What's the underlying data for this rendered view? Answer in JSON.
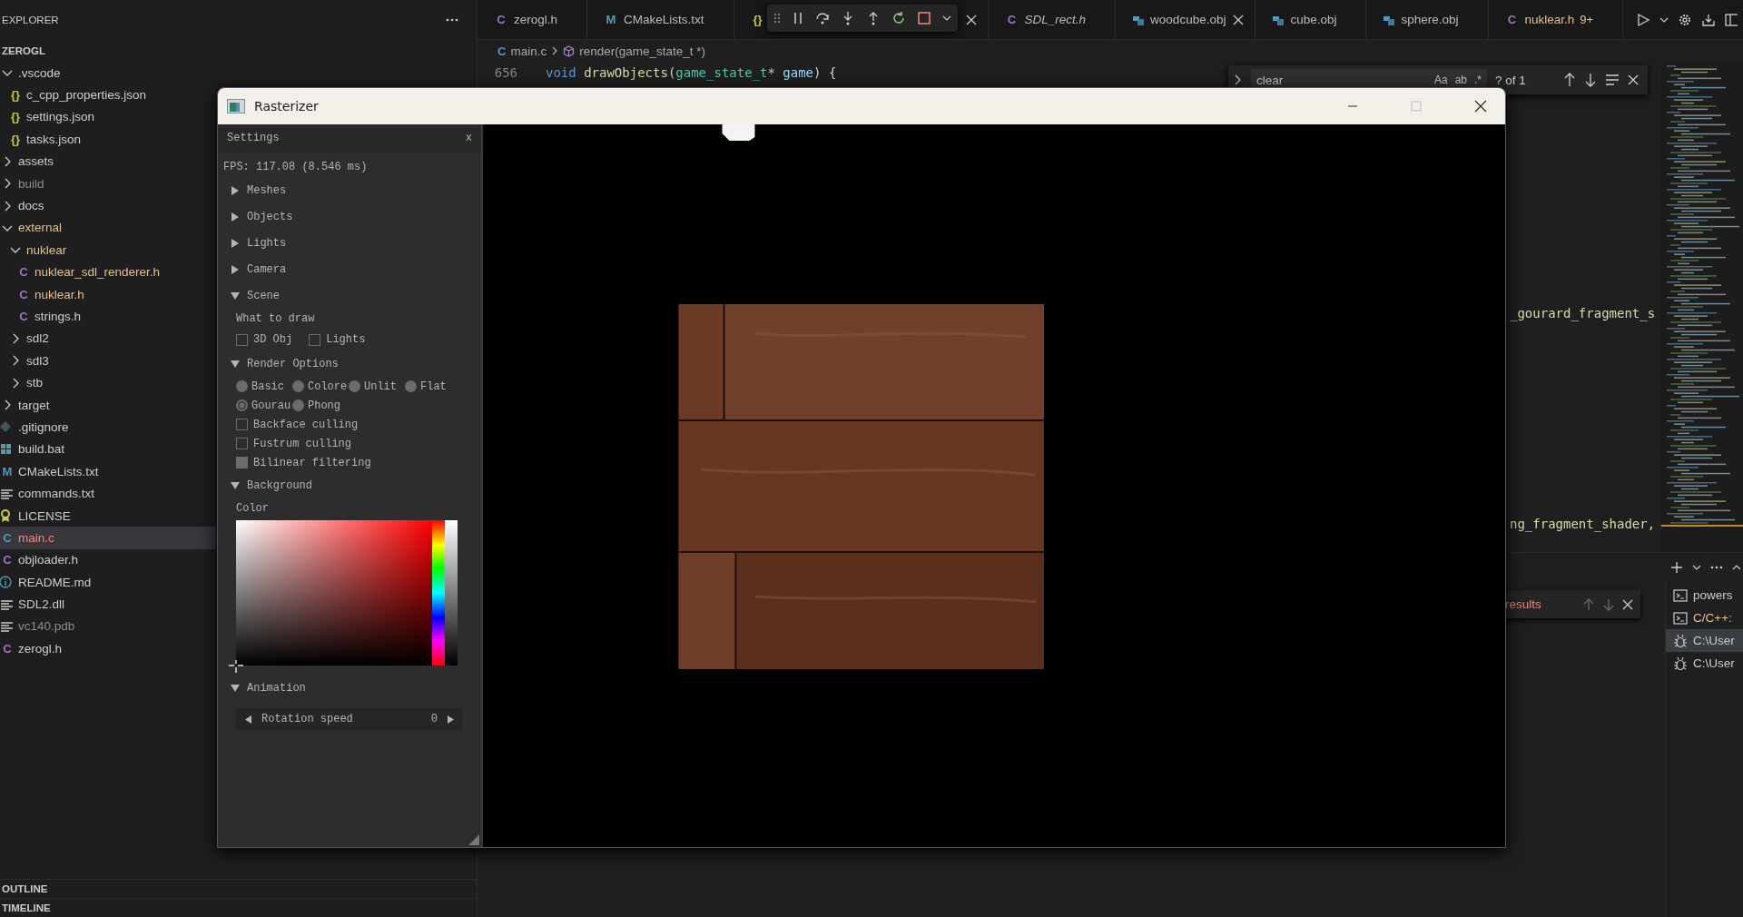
{
  "explorer": {
    "title": "EXPLORER",
    "root": "ZEROGL",
    "tree": [
      {
        "kind": "folder",
        "name": ".vscode",
        "expanded": true,
        "selected": false,
        "children": [
          {
            "kind": "json",
            "glyph": "{}",
            "name": "c_cpp_properties.json",
            "selected": false
          },
          {
            "kind": "json",
            "glyph": "{}",
            "name": "settings.json",
            "selected": false
          },
          {
            "kind": "json",
            "glyph": "{}",
            "name": "tasks.json",
            "selected": false
          }
        ]
      },
      {
        "kind": "folder",
        "name": "assets",
        "expanded": false,
        "selected": false
      },
      {
        "kind": "folder",
        "name": "build",
        "expanded": false,
        "selected": false,
        "ignored": true
      },
      {
        "kind": "folder",
        "name": "docs",
        "expanded": false,
        "selected": false
      },
      {
        "kind": "folder",
        "name": "external",
        "expanded": true,
        "selected": false,
        "modified": true,
        "children": [
          {
            "kind": "folder",
            "name": "nuklear",
            "expanded": true,
            "selected": false,
            "modified": true,
            "children": [
              {
                "kind": "h",
                "glyph": "C",
                "name": "nuklear_sdl_renderer.h",
                "selected": false,
                "modified": true
              },
              {
                "kind": "h",
                "glyph": "C",
                "name": "nuklear.h",
                "selected": false,
                "modified": true
              },
              {
                "kind": "h",
                "glyph": "C",
                "name": "strings.h",
                "selected": false
              }
            ]
          },
          {
            "kind": "folder",
            "name": "sdl2",
            "expanded": false,
            "selected": false
          },
          {
            "kind": "folder",
            "name": "sdl3",
            "expanded": false,
            "selected": false
          },
          {
            "kind": "folder",
            "name": "stb",
            "expanded": false,
            "selected": false
          }
        ]
      },
      {
        "kind": "folder",
        "name": "target",
        "expanded": false,
        "selected": false
      },
      {
        "kind": "git",
        "name": ".gitignore",
        "selected": false
      },
      {
        "kind": "windows",
        "name": "build.bat",
        "selected": false
      },
      {
        "kind": "cmake",
        "glyph": "M",
        "name": "CMakeLists.txt",
        "selected": false
      },
      {
        "kind": "text",
        "name": "commands.txt",
        "selected": false
      },
      {
        "kind": "license",
        "name": "LICENSE",
        "selected": false
      },
      {
        "kind": "c",
        "glyph": "C",
        "name": "main.c",
        "selected": true,
        "has_errors": true
      },
      {
        "kind": "h",
        "glyph": "C",
        "name": "objloader.h",
        "selected": false
      },
      {
        "kind": "info",
        "name": "README.md",
        "selected": false
      },
      {
        "kind": "text",
        "name": "SDL2.dll",
        "selected": false
      },
      {
        "kind": "text",
        "name": "vc140.pdb",
        "selected": false,
        "ignored": true
      },
      {
        "kind": "h",
        "glyph": "C",
        "name": "zerogl.h",
        "selected": false
      }
    ],
    "panels": [
      {
        "title": "OUTLINE"
      },
      {
        "title": "TIMELINE"
      }
    ]
  },
  "tabs": [
    {
      "kind": "h",
      "glyph": "C",
      "label": "zerogl.h"
    },
    {
      "kind": "cmake",
      "glyph": "M",
      "label": "CMakeLists.txt"
    },
    {
      "kind": "json",
      "glyph": "{}",
      "closable": true
    },
    {
      "kind": "h",
      "glyph": "C",
      "label": "SDL_rect.h",
      "preview": true
    },
    {
      "kind": "obj",
      "label": "woodcube.obj",
      "closable": true
    },
    {
      "kind": "obj",
      "label": "cube.obj"
    },
    {
      "kind": "obj",
      "label": "sphere.obj"
    },
    {
      "kind": "h",
      "glyph": "C",
      "label": "nuklear.h",
      "modified": true,
      "badge": "9+"
    }
  ],
  "breadcrumb": [
    {
      "kind": "c",
      "glyph": "C",
      "label": "main.c"
    },
    {
      "kind": "symbol",
      "label": "render(game_state_t *)"
    }
  ],
  "code": {
    "line": {
      "number": "656",
      "tokens": [
        {
          "text": "void ",
          "kind": "keyword"
        },
        {
          "text": "drawObjects",
          "kind": "function"
        },
        {
          "text": "("
        },
        {
          "text": "game_state_t",
          "kind": "type"
        },
        {
          "text": "* "
        },
        {
          "text": "game",
          "kind": "param"
        },
        {
          "text": ") {"
        }
      ]
    },
    "fragments": [
      {
        "text": "_gourard_fragment_s",
        "kind": "function"
      },
      {
        "text": "ng_fragment_shader,",
        "kind": "function"
      }
    ]
  },
  "find": {
    "value": "clear",
    "options": [
      "Aa",
      "ab",
      ".*"
    ],
    "count": "? of 1"
  },
  "rasterizer": {
    "title": "Rasterizer",
    "settings": {
      "title": "Settings",
      "close": "x",
      "fps": "FPS: 117.08 (8.546 ms)",
      "sections": [
        {
          "title": "Meshes",
          "expanded": false
        },
        {
          "title": "Objects",
          "expanded": false
        },
        {
          "title": "Lights",
          "expanded": false
        },
        {
          "title": "Camera",
          "expanded": false
        },
        {
          "title": "Scene",
          "expanded": true,
          "items": [
            {
              "kind": "label",
              "text": "What to draw"
            },
            {
              "kind": "checkbox_row",
              "options": [
                {
                  "label": "3D Obj",
                  "checked": false
                },
                {
                  "label": "Lights",
                  "checked": false
                }
              ]
            }
          ]
        },
        {
          "title": "Render Options",
          "expanded": true,
          "items": [
            {
              "kind": "radio_row",
              "options": [
                {
                  "label": "Basic",
                  "selected": false
                },
                {
                  "label": "Colore",
                  "selected": false
                },
                {
                  "label": "Unlit",
                  "selected": false
                },
                {
                  "label": "Flat",
                  "selected": false
                }
              ]
            },
            {
              "kind": "radio_row",
              "options": [
                {
                  "label": "Gourau",
                  "selected": true
                },
                {
                  "label": "Phong",
                  "selected": false
                }
              ]
            },
            {
              "kind": "checkbox",
              "label": "Backface culling",
              "checked": false
            },
            {
              "kind": "checkbox",
              "label": "Fustrum culling",
              "checked": false
            },
            {
              "kind": "checkbox",
              "label": "Bilinear filtering",
              "checked": true
            }
          ]
        },
        {
          "title": "Background",
          "expanded": true,
          "items": [
            {
              "kind": "label",
              "text": "Color"
            },
            {
              "kind": "color_picker"
            }
          ]
        },
        {
          "title": "Animation",
          "expanded": true,
          "items": [
            {
              "kind": "property",
              "label": "Rotation speed",
              "value": "0"
            }
          ]
        }
      ]
    }
  },
  "panel": {
    "find": {
      "text": "results"
    },
    "terminals": [
      {
        "kind": "shell",
        "label": "powers",
        "selected": false
      },
      {
        "kind": "task",
        "label": "C/C++:",
        "selected": false
      },
      {
        "kind": "debug",
        "label": "C:\\User",
        "selected": true
      },
      {
        "kind": "debug",
        "label": "C:\\User",
        "selected": false
      }
    ]
  }
}
